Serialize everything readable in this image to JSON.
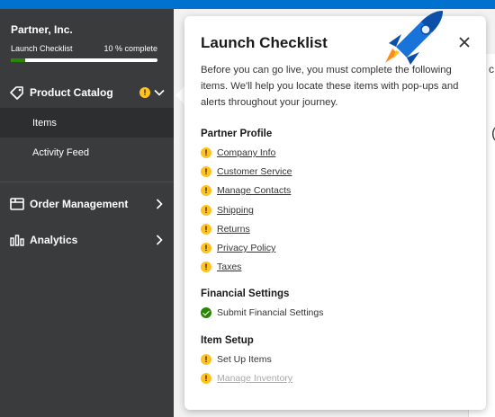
{
  "sidebar": {
    "company": "Partner, Inc.",
    "launch_checklist_label": "Launch Checklist",
    "percent_label": "10 % complete",
    "progress": 0.1,
    "nav": {
      "product_catalog": "Product Catalog",
      "items": "Items",
      "activity_feed": "Activity Feed",
      "order_management": "Order Management",
      "analytics": "Analytics"
    }
  },
  "background": {
    "fragment_1": "c",
    "fragment_2": "("
  },
  "checklist": {
    "title": "Launch Checklist",
    "intro": "Before you can go live, you must complete the following items. We'll help you locate these items with pop-ups and alerts throughout your journey.",
    "sections": [
      {
        "title": "Partner Profile",
        "items": [
          {
            "label": "Company Info",
            "status": "warning",
            "link": true
          },
          {
            "label": "Customer Service",
            "status": "warning",
            "link": true
          },
          {
            "label": "Manage Contacts",
            "status": "warning",
            "link": true
          },
          {
            "label": "Shipping",
            "status": "warning",
            "link": true
          },
          {
            "label": "Returns",
            "status": "warning",
            "link": true
          },
          {
            "label": "Privacy Policy",
            "status": "warning",
            "link": true
          },
          {
            "label": "Taxes",
            "status": "warning",
            "link": true
          }
        ]
      },
      {
        "title": "Financial Settings",
        "items": [
          {
            "label": "Submit Financial Settings",
            "status": "complete",
            "link": false
          }
        ]
      },
      {
        "title": "Item Setup",
        "items": [
          {
            "label": "Set Up Items",
            "status": "warning",
            "link": false
          },
          {
            "label": "Manage Inventory",
            "status": "warning",
            "link": true,
            "disabled": true
          }
        ]
      }
    ]
  },
  "icons": {
    "warning": "exclamation-circle",
    "complete": "check-circle",
    "close": "close-x",
    "decoration": "rocket"
  },
  "colors": {
    "sidebar_bg": "#3a3b3c",
    "accent_blue": "#0071ce",
    "warning_yellow": "#ffc220",
    "success_green": "#2a8703"
  }
}
